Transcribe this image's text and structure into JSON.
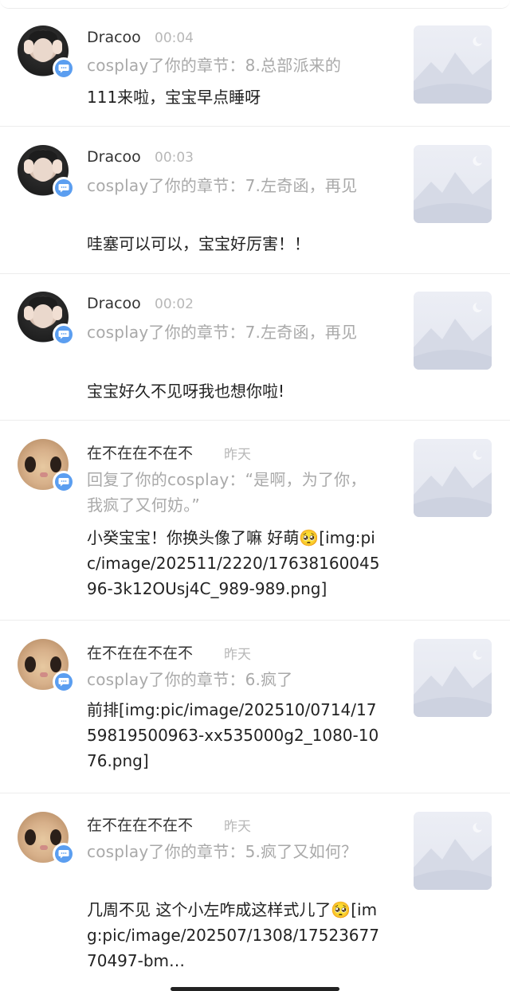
{
  "notifications": [
    {
      "name": "Dracoo",
      "time": "00:04",
      "avatar": "boy",
      "meta": "cosplay了你的章节：8.总部派来的",
      "content": "111来啦，宝宝早点睡呀"
    },
    {
      "name": "Dracoo",
      "time": "00:03",
      "avatar": "boy",
      "meta": "cosplay了你的章节：7.左奇函，再见",
      "content": "哇塞可以可以，宝宝好厉害！！"
    },
    {
      "name": "Dracoo",
      "time": "00:02",
      "avatar": "boy",
      "meta": "cosplay了你的章节：7.左奇函，再见",
      "content": "宝宝好久不见呀我也想你啦!"
    },
    {
      "name": "在不在在不在不",
      "time": "昨天",
      "avatar": "cat",
      "meta": "回复了你的cosplay：“是啊，为了你，我疯了又何妨。”",
      "content": "小癸宝宝！你换头像了嘛 好萌🥺[img:pic/image/202511/2220/1763816004596-3k12OUsj4C_989-989.png]"
    },
    {
      "name": "在不在在不在不",
      "time": "昨天",
      "avatar": "cat",
      "meta": "cosplay了你的章节：6.疯了",
      "content": "前排[img:pic/image/202510/0714/1759819500963-xx535000g2_1080-1076.png]"
    },
    {
      "name": "在不在在不在不",
      "time": "昨天",
      "avatar": "cat",
      "meta": "cosplay了你的章节：5.疯了又如何？",
      "content": "几周不见 这个小左咋成这样式儿了🥺[img:pic/image/202507/1308/1752367770497-bm…"
    }
  ],
  "icons": {
    "badge": "comment-bubble-icon",
    "thumbnail": "mountain-placeholder-icon"
  },
  "colors": {
    "badge": "#5b9ef0",
    "meta": "#a9a9a9",
    "time": "#b8b8b8"
  }
}
